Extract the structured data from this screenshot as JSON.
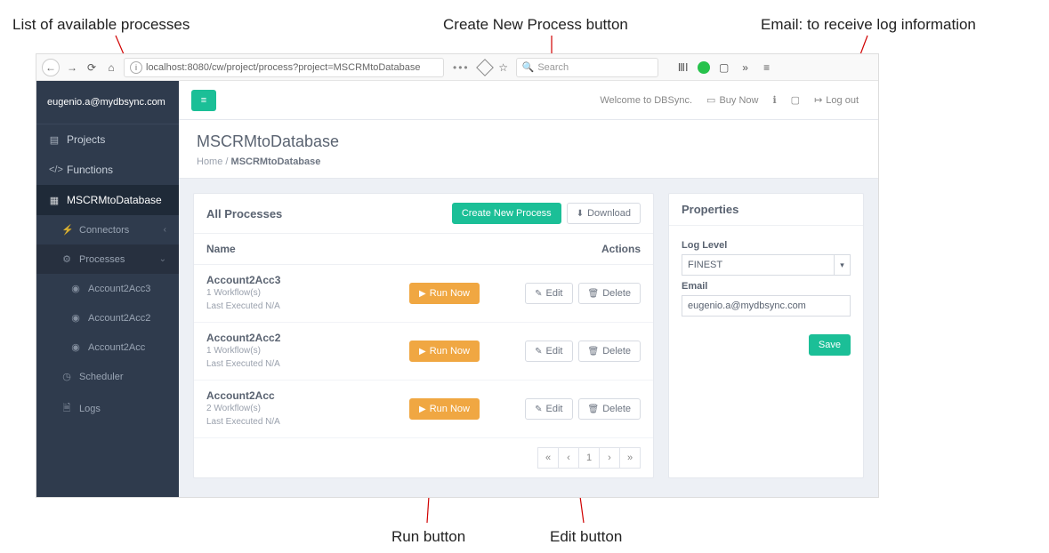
{
  "callouts": {
    "list_of_processes": "List of available processes",
    "create_new": "Create New Process button",
    "email_info": "Email: to receive log information",
    "run_button": "Run button",
    "edit_button": "Edit button"
  },
  "browser": {
    "url": "localhost:8080/cw/project/process?project=MSCRMtoDatabase",
    "search_placeholder": "Search"
  },
  "sidebar": {
    "user": "eugenio.a@mydbsync.com",
    "projects": "Projects",
    "functions": "Functions",
    "project_name": "MSCRMtoDatabase",
    "connectors": "Connectors",
    "processes": "Processes",
    "process_items": [
      "Account2Acc3",
      "Account2Acc2",
      "Account2Acc"
    ],
    "scheduler": "Scheduler",
    "logs": "Logs"
  },
  "topbar": {
    "welcome": "Welcome to DBSync.",
    "buy_now": "Buy Now",
    "logout": "Log out"
  },
  "page": {
    "title": "MSCRMtoDatabase",
    "crumb_home": "Home",
    "crumb_current": "MSCRMtoDatabase"
  },
  "processes_panel": {
    "title": "All Processes",
    "create_btn": "Create New Process",
    "download_btn": "Download",
    "col_name": "Name",
    "col_actions": "Actions",
    "run_label": "Run Now",
    "edit_label": "Edit",
    "delete_label": "Delete",
    "rows": [
      {
        "name": "Account2Acc3",
        "workflows": "1 Workflow(s)",
        "last": "Last Executed N/A"
      },
      {
        "name": "Account2Acc2",
        "workflows": "1 Workflow(s)",
        "last": "Last Executed N/A"
      },
      {
        "name": "Account2Acc",
        "workflows": "2 Workflow(s)",
        "last": "Last Executed N/A"
      }
    ],
    "page_current": "1"
  },
  "properties_panel": {
    "title": "Properties",
    "log_level_label": "Log Level",
    "log_level_value": "FINEST",
    "email_label": "Email",
    "email_value": "eugenio.a@mydbsync.com",
    "save": "Save"
  }
}
